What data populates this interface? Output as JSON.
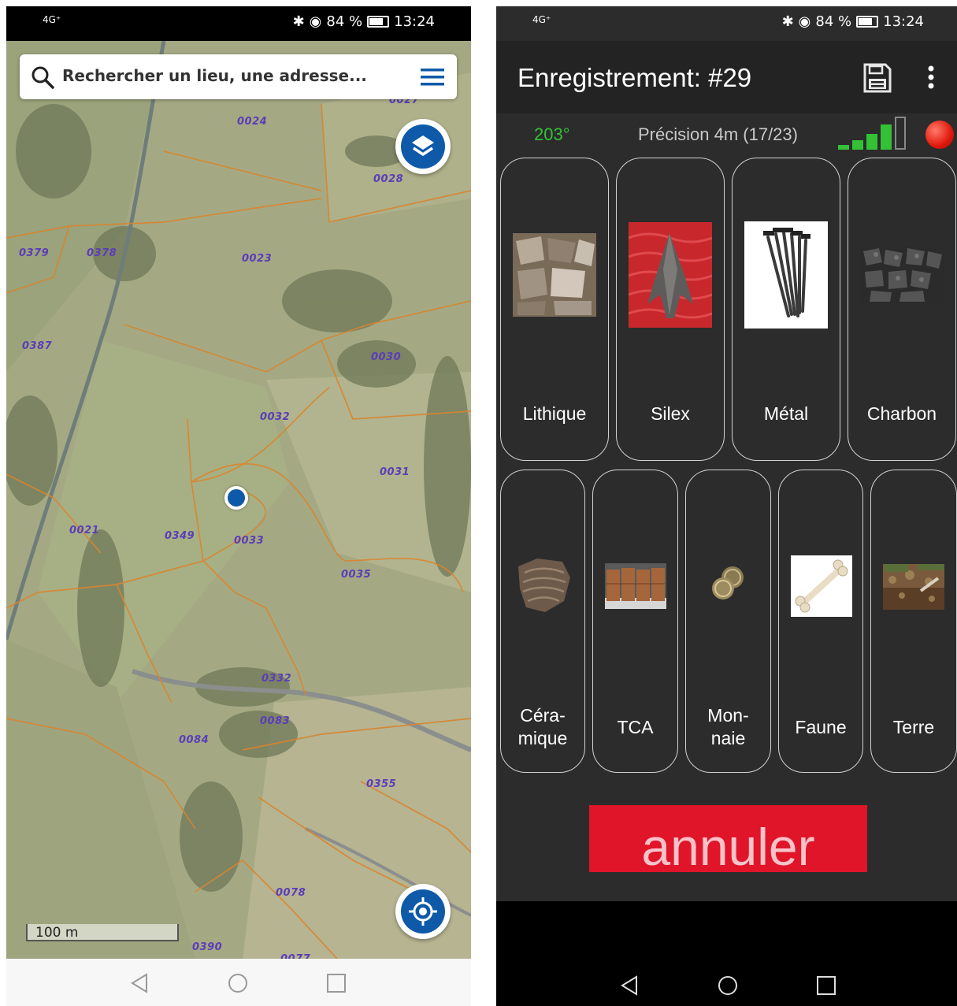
{
  "left_screen": {
    "status_bar": {
      "network": "4G⁺",
      "battery": "84 %",
      "time": "13:24"
    },
    "search": {
      "placeholder": "Rechercher un lieu, une adresse...",
      "search_icon": "search-icon",
      "menu_icon": "hamburger-menu-icon"
    },
    "layers_button": {
      "icon": "layers-icon"
    },
    "locate_button": {
      "icon": "gps-target-icon"
    },
    "scale": "100 m",
    "parcels": [
      "0027",
      "0024",
      "0028",
      "0379",
      "0378",
      "0023",
      "0387",
      "0030",
      "0032",
      "0031",
      "0021",
      "0349",
      "0033",
      "0035",
      "0332",
      "0083",
      "0084",
      "0355",
      "0078",
      "0390",
      "0077"
    ],
    "nav": [
      "back-icon",
      "home-icon",
      "recents-icon"
    ],
    "colors": {
      "map_bg": "#a5ab84",
      "parcel_line": "#d9852f",
      "accent": "#0e5aa8",
      "label": "#5b3db8"
    }
  },
  "right_screen": {
    "status_bar": {
      "network": "4G⁺",
      "battery": "84 %",
      "time": "13:24"
    },
    "title": "Enregistrement: #29",
    "save_icon": "save-floppy-icon",
    "more_icon": "more-vert-icon",
    "bearing": "203°",
    "precision": "Précision 4m (17/23)",
    "signal_level": "4 of 5 bars",
    "record_icon": "record-red-dot-icon",
    "categories_row1": [
      {
        "label": "Lithique",
        "icon": "stones-image"
      },
      {
        "label": "Silex",
        "icon": "flint-arrowhead-image"
      },
      {
        "label": "Métal",
        "icon": "metal-nails-image"
      },
      {
        "label": "Charbon",
        "icon": "coal-image"
      }
    ],
    "categories_row2": [
      {
        "label": "Céra-\nmique",
        "icon": "ceramic-shard-image"
      },
      {
        "label": "TCA",
        "icon": "roof-tiles-image"
      },
      {
        "label": "Mon-\nnaie",
        "icon": "coins-image"
      },
      {
        "label": "Faune",
        "icon": "bone-image"
      },
      {
        "label": "Terre",
        "icon": "soil-image"
      }
    ],
    "cancel_label": "annuler",
    "nav": [
      "back-icon",
      "home-icon",
      "recents-icon"
    ],
    "colors": {
      "bg": "#2c2c2c",
      "appbar": "#232323",
      "green": "#33c236",
      "cancel": "#e0152a"
    }
  }
}
